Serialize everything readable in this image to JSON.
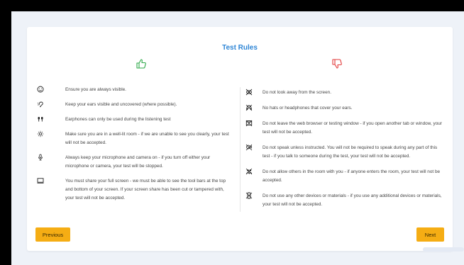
{
  "title": "Test Rules",
  "icons": {
    "do": "thumbs-up-icon",
    "dont": "thumbs-down-icon"
  },
  "colors": {
    "title": "#2f86d6",
    "thumbs_up": "#2fa94a",
    "thumbs_down": "#e23b3b",
    "button": "#f5ad14",
    "background": "#eef2f8"
  },
  "do_rules": [
    {
      "icon": "face-icon",
      "text": "Ensure you are always visible."
    },
    {
      "icon": "ear-icon",
      "text": "Keep your ears visible and uncovered (where possible)."
    },
    {
      "icon": "earphones-icon",
      "text": "Earphones can only be used during the listening test"
    },
    {
      "icon": "light-icon",
      "text": "Make sure you are in a well-lit room - if we are unable to see you clearly, your test will not be accepted."
    },
    {
      "icon": "microphone-icon",
      "text": "Always keep your microphone and camera on - if you turn off either your microphone or camera, your test will be stopped."
    },
    {
      "icon": "screen-icon",
      "text": "You must share your full screen - we must be able to see the tool bars at the top and bottom of your screen. If your screen share has been cut or tampered with, your test will not be accepted."
    }
  ],
  "dont_rules": [
    {
      "icon": "no-look-away-icon",
      "text": "Do not look away from the screen."
    },
    {
      "icon": "no-headwear-icon",
      "text": "No hats or headphones that cover your ears."
    },
    {
      "icon": "no-browser-leave-icon",
      "text": "Do not leave the web browser or testing window - if you open another tab or window, your test will not be accepted."
    },
    {
      "icon": "no-speaking-icon",
      "text": "Do not speak unless instructed. You will not be required to speak during any part of this test - if you talk to someone during the test, your test will not be accepted."
    },
    {
      "icon": "no-others-icon",
      "text": "Do not allow others in the room with you - if anyone enters the room, your test will not be accepted."
    },
    {
      "icon": "no-devices-icon",
      "text": "Do not use any other devices or materials - if you use any additional devices or materials, your test will not be accepted."
    }
  ],
  "buttons": {
    "previous": "Previous",
    "next": "Next"
  }
}
